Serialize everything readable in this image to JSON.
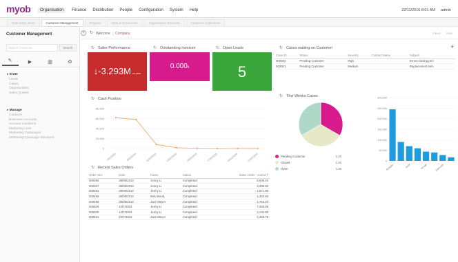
{
  "topbar": {
    "logo": "myob",
    "menu": [
      "Organisation",
      "Finance",
      "Distribution",
      "People",
      "Configuration",
      "System",
      "Help"
    ],
    "active_menu_index": 0,
    "datetime": "22/11/2016 8:01 AM",
    "user": "admin"
  },
  "tabs": [
    "Data Entry Items",
    "Customer Management",
    "Projects",
    "Data & Documents",
    "Organisation Structure",
    "Customer Collections"
  ],
  "active_tab_index": 1,
  "sidebar": {
    "title": "Customer Management",
    "search_placeholder": "Search Customer",
    "search_button": "Search",
    "enter": {
      "header": "Enter",
      "items": [
        "Leads",
        "Cases",
        "Opportunities",
        "Sales Quotes"
      ]
    },
    "manage": {
      "header": "Manage",
      "items": [
        "Contacts",
        "Business Accounts",
        "Account Locations",
        "Marketing Lists",
        "Marketing Campaigns",
        "Marketing Campaign Members"
      ]
    }
  },
  "breadcrumb": {
    "items": [
      "Welcome",
      "Company"
    ],
    "right": [
      "Views",
      "Help"
    ]
  },
  "widgets": {
    "sales_performance": {
      "title": "Sales Performance",
      "value": "↓-3.293M",
      "suffix": "vs. prev",
      "color": "#c72c2c"
    },
    "outstanding_invoices": {
      "title": "Outstanding Invoices",
      "value": "0.000",
      "suffix": "k",
      "color": "#d81b8c"
    },
    "open_leads": {
      "title": "Open Leads",
      "value": "5",
      "color": "#3aa53a"
    },
    "cases_waiting": {
      "title": "Cases waiting on Customer",
      "add_label": "+",
      "columns": [
        "Case ID",
        "Status",
        "Severity",
        "Contact Name",
        "Subject"
      ],
      "rows": [
        [
          "000002",
          "Pending Customer",
          "High",
          "",
          "Errors closing peri"
        ],
        [
          "000001",
          "Pending Customer",
          "Medium",
          "",
          "Replacement item"
        ]
      ]
    },
    "cash_position": {
      "title": "Cash Position"
    },
    "this_week_cases": {
      "title": "This Weeks Cases"
    },
    "recent_sales": {
      "title": "Recent Sales Orders",
      "columns": [
        "Order Nbr.",
        "Date",
        "Name",
        "Status",
        "Sales Order - sorted T"
      ],
      "rows": [
        [
          "000486",
          "28/06/2013",
          "Jenny Li",
          "Completed",
          "8,635.40"
        ],
        [
          "000487",
          "28/06/2013",
          "Jenny Li",
          "Completed",
          "3,336.50"
        ],
        [
          "000492",
          "28/06/2013",
          "Jenny Li",
          "Completed",
          "1,571.90"
        ],
        [
          "000495",
          "28/06/2013",
          "Bob Wood",
          "Completed",
          "1,263.60"
        ],
        [
          "000498",
          "28/06/2013",
          "Jazz Meyer",
          "Completed",
          "1,763.40"
        ],
        [
          "000529",
          "1/07/2013",
          "Jenny Li",
          "Completed",
          "7,309.08"
        ],
        [
          "000530",
          "1/07/2013",
          "Jenny Li",
          "Completed",
          "2,132.80"
        ],
        [
          "000531",
          "4/07/2013",
          "Jazz Meyer",
          "Completed",
          "2,468.75"
        ]
      ]
    }
  },
  "chart_data": [
    {
      "type": "line",
      "x": [
        "7/02/2016",
        "9/02/2016",
        "11/02/2016",
        "13/02/2016",
        "15/02/2016",
        "17/02/2016",
        "19/02/2016",
        "21/02/2016"
      ],
      "values": [
        62000,
        58000,
        8000,
        1500,
        500,
        300,
        200,
        100
      ],
      "ylim": [
        0,
        80000
      ],
      "yticks": [
        "80,000",
        "60,000",
        "40,000",
        "20,000",
        "0"
      ],
      "color": "#f5a15c"
    },
    {
      "type": "pie",
      "slices": [
        {
          "name": "Pending Customer",
          "value": 1.0,
          "label": "1.00",
          "color": "#d81b8c"
        },
        {
          "name": "Closed",
          "value": 1.0,
          "label": "1.00",
          "color": "#e6e8c8"
        },
        {
          "name": "Open",
          "value": 1.0,
          "label": "1.00",
          "color": "#aed8c8"
        }
      ]
    },
    {
      "type": "bar",
      "categories": [
        "Cust A",
        "Cust B",
        "Cust C",
        "Cust D",
        "Cust E",
        "Cust F",
        "Cust G",
        "Cust H"
      ],
      "xtick_labels": [
        "Dunphy",
        "",
        "Kehl",
        "",
        "Novak",
        "",
        "Samuels",
        ""
      ],
      "values": [
        245000,
        90000,
        70000,
        60000,
        44000,
        40000,
        28000,
        17000
      ],
      "ylim": [
        0,
        300000
      ],
      "yticks": [
        "300,000",
        "250,000",
        "200,000",
        "150,000",
        "100,000",
        "50,000",
        "0"
      ],
      "color": "#1f9ce0"
    }
  ]
}
